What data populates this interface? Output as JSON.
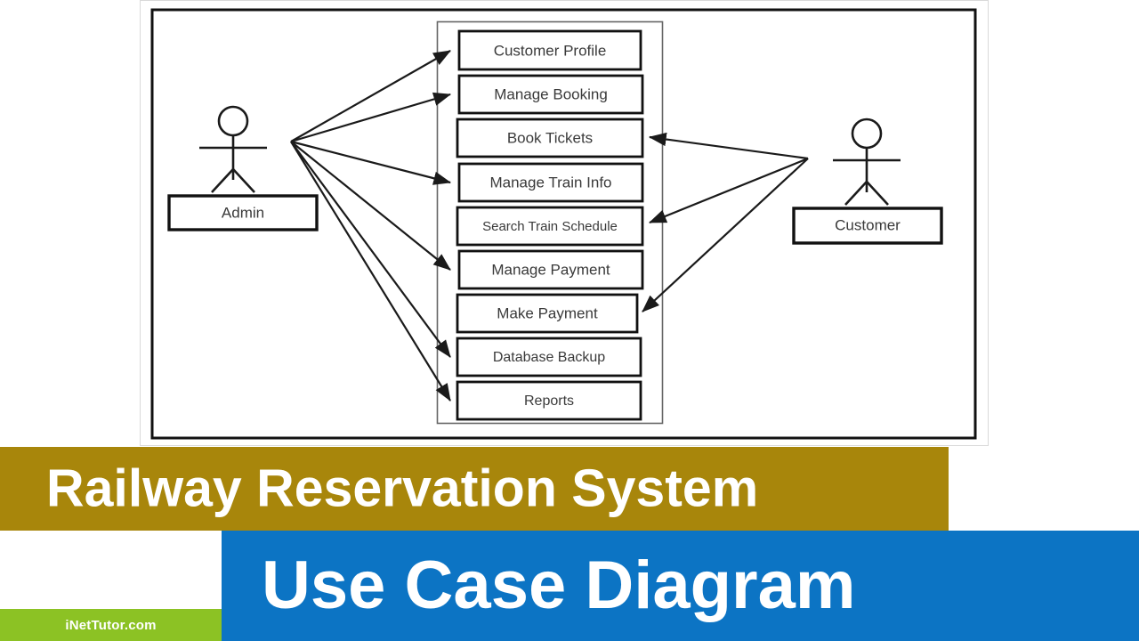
{
  "banners": {
    "gold_title": "Railway Reservation System",
    "blue_title": "Use Case Diagram",
    "logo_text": "iNetTutor.com",
    "gold_color": "#a8860b",
    "blue_color": "#0c74c4",
    "green_color": "#8cc224",
    "title_color": "#ffffff"
  },
  "diagram": {
    "type": "uml-use-case-diagram",
    "line_color": "#1a1a1a",
    "text_color": "#3a3a3a",
    "actors": [
      {
        "id": "admin",
        "label": "Admin"
      },
      {
        "id": "customer",
        "label": "Customer"
      }
    ],
    "use_cases": [
      {
        "id": "uc1",
        "label": "Customer Profile"
      },
      {
        "id": "uc2",
        "label": "Manage Booking"
      },
      {
        "id": "uc3",
        "label": "Book Tickets"
      },
      {
        "id": "uc4",
        "label": "Manage Train Info"
      },
      {
        "id": "uc5",
        "label": "Search Train Schedule"
      },
      {
        "id": "uc6",
        "label": "Manage Payment"
      },
      {
        "id": "uc7",
        "label": "Make Payment"
      },
      {
        "id": "uc8",
        "label": "Database Backup"
      },
      {
        "id": "uc9",
        "label": "Reports"
      }
    ],
    "associations": [
      {
        "from": "admin",
        "to": "uc1"
      },
      {
        "from": "admin",
        "to": "uc2"
      },
      {
        "from": "admin",
        "to": "uc4"
      },
      {
        "from": "admin",
        "to": "uc6"
      },
      {
        "from": "admin",
        "to": "uc8"
      },
      {
        "from": "admin",
        "to": "uc9"
      },
      {
        "from": "customer",
        "to": "uc3"
      },
      {
        "from": "customer",
        "to": "uc5"
      },
      {
        "from": "customer",
        "to": "uc7"
      }
    ]
  }
}
